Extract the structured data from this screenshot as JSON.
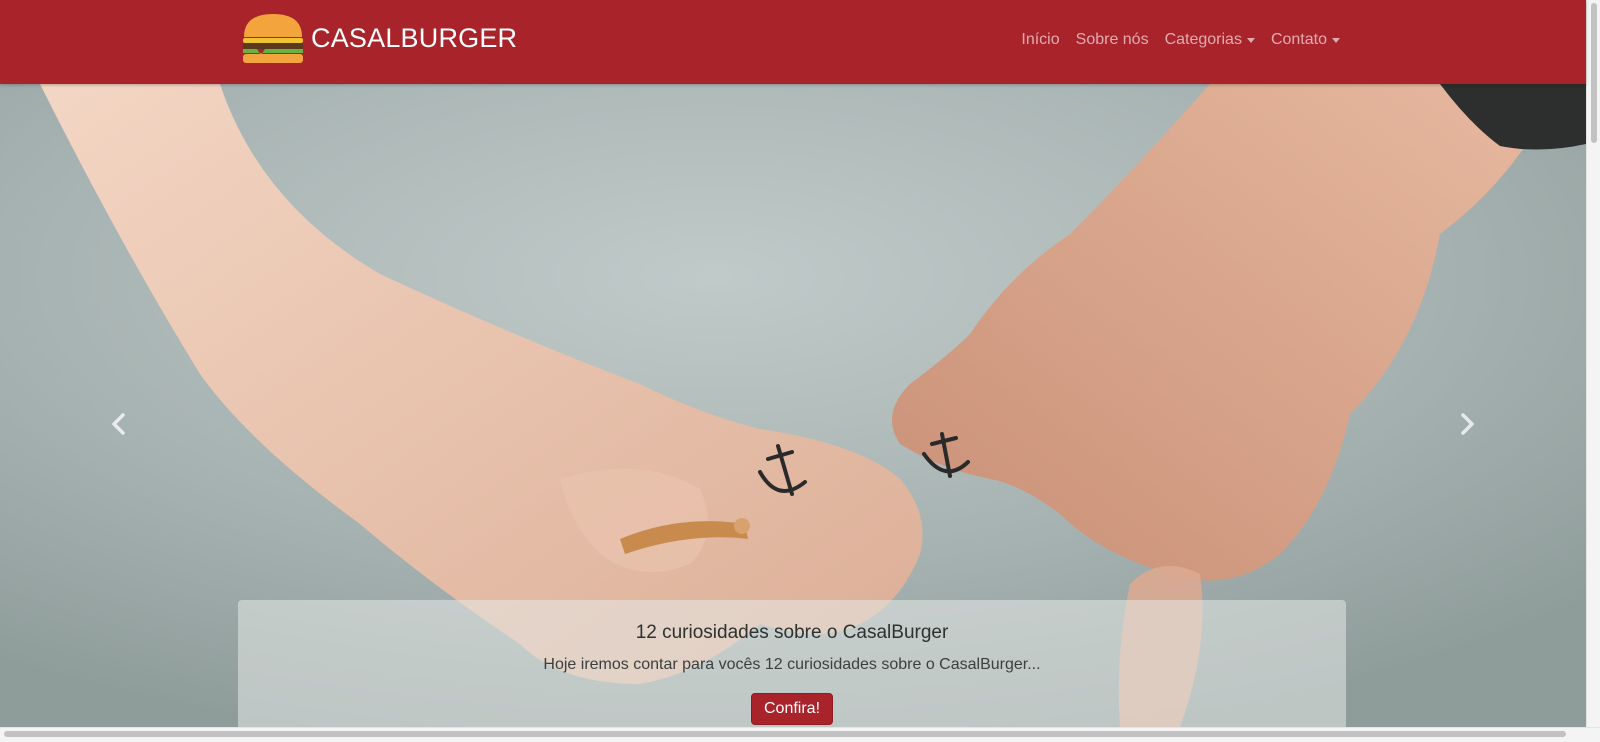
{
  "brand": {
    "name": "CASALBURGER",
    "logo_icon": "burger-icon"
  },
  "nav": {
    "items": [
      {
        "label": "Início"
      },
      {
        "label": "Sobre nós"
      },
      {
        "label": "Categorias",
        "dropdown": true
      },
      {
        "label": "Contato",
        "dropdown": true
      }
    ]
  },
  "carousel": {
    "prev_icon": "chevron-left-icon",
    "next_icon": "chevron-right-icon",
    "slide": {
      "image": "couple-holding-pinky-fingers-anchor-tattoos-photo",
      "title": "12 curiosidades sobre o CasalBurger",
      "text": "Hoje iremos contar para vocês 12 curiosidades sobre o CasalBurger...",
      "button_label": "Confira!"
    }
  },
  "colors": {
    "brand_red": "#a9232a",
    "nav_link": "rgba(255,255,255,0.62)",
    "white": "#ffffff"
  }
}
